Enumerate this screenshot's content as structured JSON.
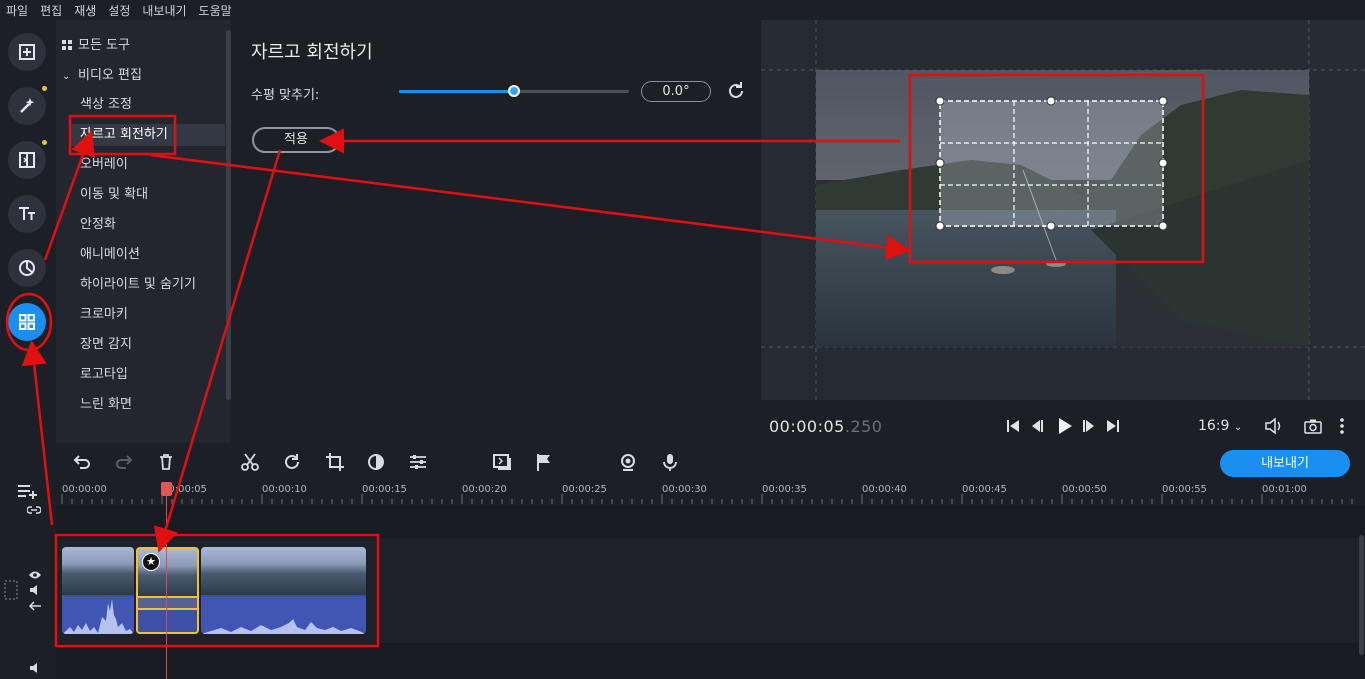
{
  "menu": [
    "파일",
    "편집",
    "재생",
    "설정",
    "내보내기",
    "도움말"
  ],
  "toolpanel": {
    "all_tools": "모든 도구",
    "video_edit": "비디오 편집",
    "items": [
      "색상 조정",
      "자르고 회전하기",
      "오버레이",
      "이동 및 확대",
      "안정화",
      "애니메이션",
      "하이라이트 및 숨기기",
      "크로마키",
      "장면 감지",
      "로고타입",
      "느린 화면"
    ],
    "selected_index": 1
  },
  "settings": {
    "title": "자르고 회전하기",
    "horizon_label": "수평 맞추기:",
    "horizon_value": "0.0°",
    "slider_fraction": 0.5,
    "apply_label": "적용"
  },
  "player": {
    "time_main": "00:00:05",
    "time_ms": ".250",
    "ratio": "16:9",
    "progress_fraction": 0.35
  },
  "toolbar": {
    "export_label": "내보내기"
  },
  "ruler": [
    "00:00:00",
    "00:00:05",
    "00:00:10",
    "00:00:15",
    "00:00:20",
    "00:00:25",
    "00:00:30",
    "00:00:35",
    "00:00:40",
    "00:00:45",
    "00:00:50",
    "00:00:55",
    "00:01:00"
  ],
  "colors": {
    "accent": "#1a8ff0",
    "annotation": "#e01010",
    "selected_clip": "#f2c12e"
  }
}
